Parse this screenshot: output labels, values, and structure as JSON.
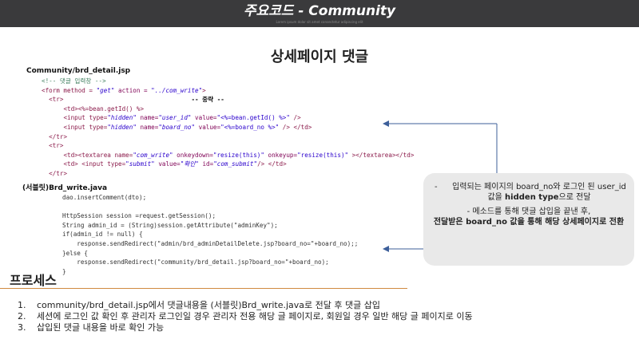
{
  "header": {
    "title": "주요코드 - Community",
    "subtitle": "Lorem ipsum dolor sit amet consectetur adipiscing elit"
  },
  "page_heading": "상세페이지 댓글",
  "jsp_file_label": "Community/brd_detail.jsp",
  "jsp_code": {
    "comment": "<!-- 댓글 입력창 -->",
    "form_open": {
      "pre": "<form method = ",
      "method": "\"get\"",
      "mid": " action = ",
      "action": "\"../com_write\"",
      "end": ">"
    },
    "tr_open": "<tr>",
    "middle_note": "-- 중략 --",
    "td_bean": "<td><%=bean.getId() %>",
    "hidden1": {
      "pre": "<input type=",
      "type": "\"hidden\"",
      "mid1": " name=",
      "name": "\"user_id\"",
      "mid2": " value=",
      "value": "\"<%=bean.getId() %>\"",
      "end": " />"
    },
    "hidden2": {
      "pre": "<input type=",
      "type": "\"hidden\"",
      "mid1": " name=",
      "name": "\"board_no\"",
      "mid2": " value=",
      "value": "\"<%=board_no %>\"",
      "end": " /> </td>"
    },
    "tr_close": "</tr>",
    "tr_open2": "<tr>",
    "textarea": {
      "pre": "<td><textarea name=",
      "name": "\"com_write\"",
      "mid1": " onkeydown=",
      "kd": "\"resize(this)\"",
      "mid2": " onkeyup=",
      "ku": "\"resize(this)\"",
      "end": " ></textarea></td>"
    },
    "submit": {
      "pre": "<td> <input type=",
      "type": "\"submit\"",
      "mid1": " value=",
      "value": "\"확인\"",
      "mid2": " id=",
      "id": "\"com_submit\"",
      "end": "/> </td>"
    },
    "tr_close2": "</tr>"
  },
  "servlet_label": "(서블릿)Brd_write.java",
  "java_code": [
    "dao.insertComment(dto);",
    "",
    "HttpSession session =request.getSession();",
    "String admin_id = (String)session.getAttribute(\"adminKey\");",
    "if(admin_id != null) {",
    "    response.sendRedirect(\"admin/brd_adminDetailDelete.jsp?board_no=\"+board_no);;",
    "}else {",
    "    response.sendRedirect(\"community/brd_detail.jsp?board_no=\"+board_no);",
    "}"
  ],
  "callout": {
    "bullet": "-",
    "line1": {
      "pre": "입력되는 페이지의 board_no와 로그인 된 user_id 값을 ",
      "bold": "hidden type",
      "post": "으로 전달"
    },
    "line2_pre": "- 메소드를 통해 댓글 삽입을 끝낸 후,",
    "line2_bold": "전달받은 board_no 값을 통해 해당 상세페이지로 전환"
  },
  "process": {
    "title": "프로세스",
    "steps": [
      {
        "num": "1.",
        "text": "community/brd_detail.jsp에서 댓글내용을 (서블릿)Brd_write.java로 전달 후 댓글 삽입"
      },
      {
        "num": "2.",
        "text": "세션에 로그인 값 확인 후 관리자 로그인일 경우 관리자 전용 해당 글 페이지로, 회원일 경우 일반 해당 글 페이지로 이동"
      },
      {
        "num": "3.",
        "text": "삽입된 댓글 내용을 바로 확인 가능"
      }
    ]
  },
  "colors": {
    "header_bg": "#3a3a3c",
    "accent_line": "#d08a40",
    "arrow": "#3d5f9a",
    "callout_bg": "#e9e9e9"
  }
}
